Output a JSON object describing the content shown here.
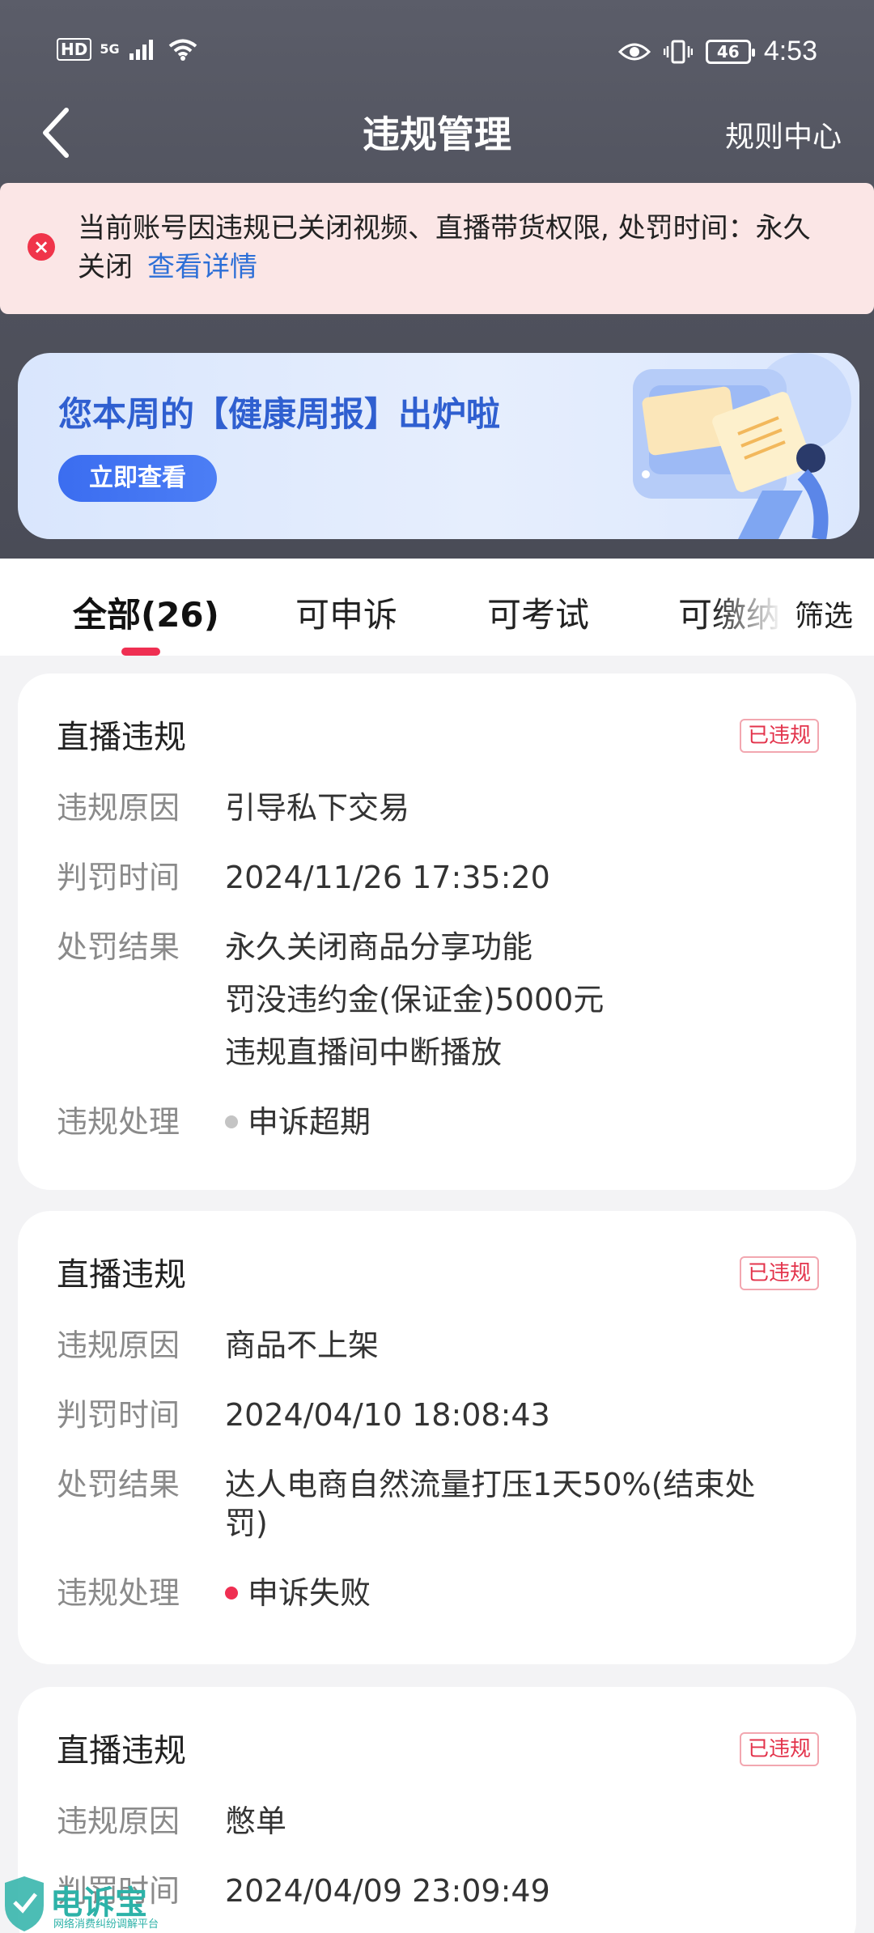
{
  "status_bar": {
    "hd": "HD",
    "network": "5G",
    "battery": "46",
    "time": "4:53"
  },
  "nav": {
    "title": "违规管理",
    "rule_center": "规则中心"
  },
  "alert": {
    "text": "当前账号因违规已关闭视频、直播带货权限, 处罚时间：永久关闭",
    "link": "查看详情"
  },
  "banner": {
    "title": "您本周的【健康周报】出炉啦",
    "button": "立即查看"
  },
  "tabs": [
    {
      "label": "全部(26)",
      "active": true
    },
    {
      "label": "可申诉",
      "active": false
    },
    {
      "label": "可考试",
      "active": false
    },
    {
      "label": "可缴纳",
      "active": false
    }
  ],
  "filter": "筛选",
  "cards": [
    {
      "title": "直播违规",
      "tag": "已违规",
      "rows": [
        {
          "label": "违规原因",
          "lines": [
            "引导私下交易"
          ]
        },
        {
          "label": "判罚时间",
          "lines": [
            "2024/11/26 17:35:20"
          ]
        },
        {
          "label": "处罚结果",
          "lines": [
            "永久关闭商品分享功能",
            "罚没违约金(保证金)5000元",
            "违规直播间中断播放"
          ]
        },
        {
          "label": "违规处理",
          "lines": [
            "申诉超期"
          ],
          "dot_color": "#c4c4c4"
        }
      ]
    },
    {
      "title": "直播违规",
      "tag": "已违规",
      "rows": [
        {
          "label": "违规原因",
          "lines": [
            "商品不上架"
          ]
        },
        {
          "label": "判罚时间",
          "lines": [
            "2024/04/10 18:08:43"
          ]
        },
        {
          "label": "处罚结果",
          "lines": [
            "达人电商自然流量打压1天50%(结束处",
            "罚)"
          ]
        },
        {
          "label": "违规处理",
          "lines": [
            "申诉失败"
          ],
          "dot_color": "#ef2f52"
        }
      ]
    },
    {
      "title": "直播违规",
      "tag": "已违规",
      "rows": [
        {
          "label": "违规原因",
          "lines": [
            "憋单"
          ]
        },
        {
          "label": "判罚时间",
          "lines": [
            "2024/04/09 23:09:49"
          ]
        }
      ]
    }
  ],
  "watermark": {
    "name": "电诉宝",
    "sub": "网络消费纠纷调解平台"
  },
  "colors": {
    "accent_red": "#ef2f52",
    "link_blue": "#2d6fd7",
    "banner_blue": "#2f5fd0"
  }
}
